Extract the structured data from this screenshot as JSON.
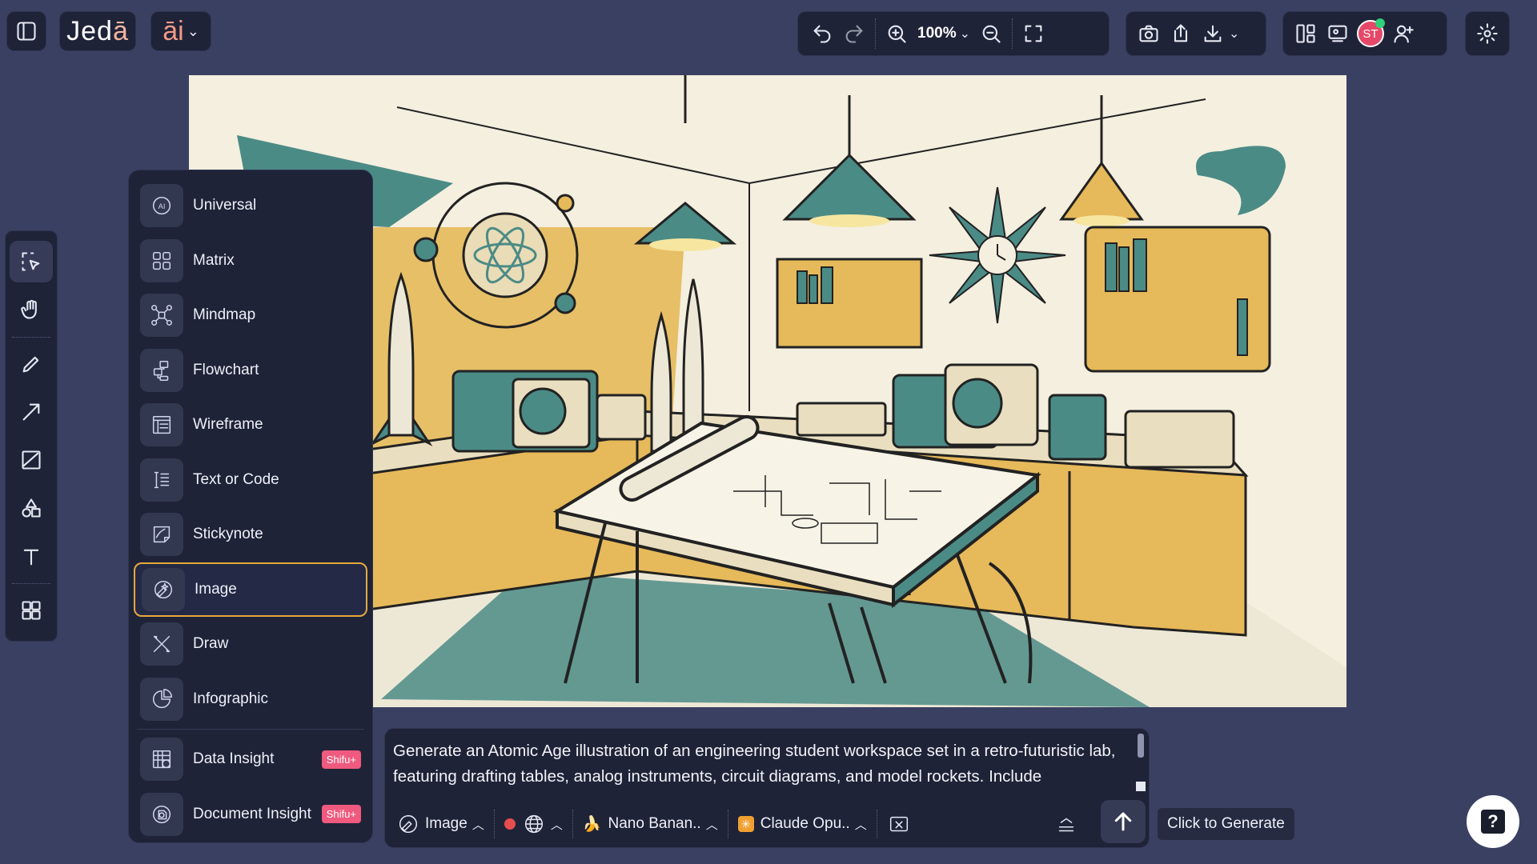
{
  "brand": {
    "logo_main": "Jed",
    "logo_accent": "ā",
    "ai_label": "āi"
  },
  "toolbar": {
    "zoom_level": "100%"
  },
  "user": {
    "initials": "ST"
  },
  "menu": {
    "items": [
      {
        "label": "Universal",
        "name": "universal"
      },
      {
        "label": "Matrix",
        "name": "matrix"
      },
      {
        "label": "Mindmap",
        "name": "mindmap"
      },
      {
        "label": "Flowchart",
        "name": "flowchart"
      },
      {
        "label": "Wireframe",
        "name": "wireframe"
      },
      {
        "label": "Text or Code",
        "name": "text-or-code"
      },
      {
        "label": "Stickynote",
        "name": "stickynote"
      },
      {
        "label": "Image",
        "name": "image",
        "selected": true
      },
      {
        "label": "Draw",
        "name": "draw"
      },
      {
        "label": "Infographic",
        "name": "infographic"
      }
    ],
    "premium_items": [
      {
        "label": "Data Insight",
        "badge": "Shifu+"
      },
      {
        "label": "Document Insight",
        "badge": "Shifu+"
      }
    ]
  },
  "prompt": {
    "text": "Generate an Atomic Age illustration of an engineering student workspace set in a retro-futuristic lab, featuring drafting tables, analog instruments, circuit diagrams, and model rockets. Include",
    "mode_label": "Image",
    "image_model": "Nano Banan..",
    "text_model": "Claude Opu..",
    "generate_tooltip": "Click to Generate"
  },
  "colors": {
    "accent_selected": "#e6a93c",
    "badge": "#ef5a7e",
    "panel": "#1f2338",
    "background": "#3a4062"
  }
}
